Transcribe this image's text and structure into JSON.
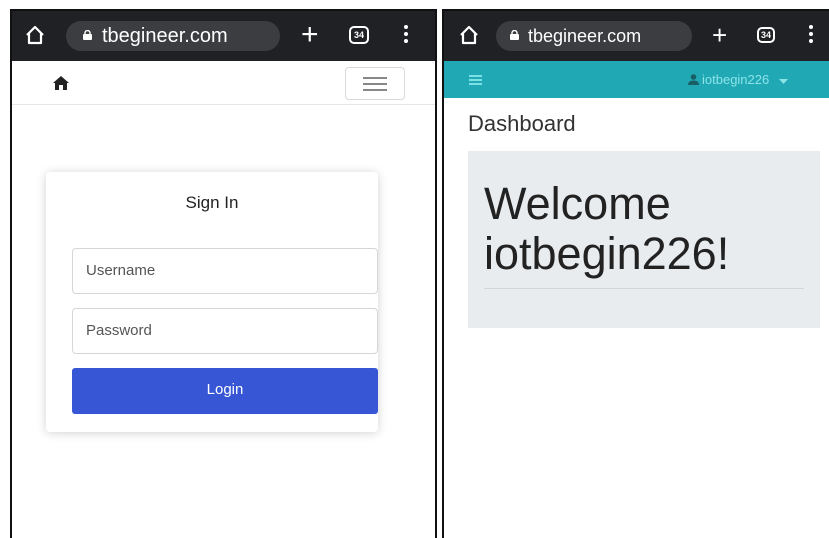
{
  "left_screen": {
    "browser": {
      "url": "tbegineer.com",
      "tab_count": "34"
    },
    "signin": {
      "title": "Sign In",
      "username_placeholder": "Username",
      "password_placeholder": "Password",
      "login_label": "Login",
      "button_color": "#3656d6"
    }
  },
  "right_screen": {
    "browser": {
      "url": "tbegineer.com",
      "tab_count": "34"
    },
    "topbar": {
      "username": "iotbegin226",
      "color": "#20a9b4"
    },
    "page_title": "Dashboard",
    "welcome_line1": "Welcome",
    "welcome_line2": "iotbegin226!"
  },
  "icons": [
    "home-icon",
    "lock-icon",
    "plus-icon",
    "tabs-count-icon",
    "menu-kebab-icon",
    "house-icon",
    "hamburger-icon",
    "user-icon",
    "caret-down-icon"
  ]
}
